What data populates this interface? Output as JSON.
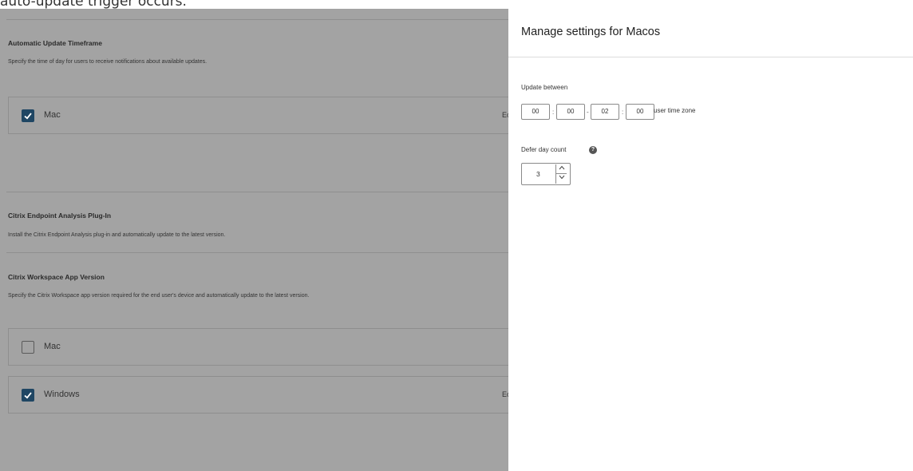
{
  "caption": "auto-update trigger occurs.",
  "background": {
    "update_timeframe": {
      "title": "Automatic Update Timeframe",
      "description": "Specify the time of day for users to receive notifications about available updates.",
      "mac_card": {
        "label": "Mac",
        "checked": true,
        "edit_label": "Ec"
      }
    },
    "epa_plugin": {
      "title": "Citrix Endpoint Analysis Plug-In",
      "description": "Install the Citrix Endpoint Analysis plug-in and automatically update to the latest version."
    },
    "app_version": {
      "title": "Citrix Workspace App Version",
      "description": "Specify the Citrix Workspace app version required for the end user's device and automatically update to the latest version.",
      "mac_card": {
        "label": "Mac",
        "checked": false
      },
      "windows_card": {
        "label": "Windows",
        "checked": true,
        "edit_label": "Ec"
      }
    }
  },
  "panel": {
    "title": "Manage settings for Macos",
    "update_between": {
      "label": "Update between",
      "start_hour": "00",
      "start_minute": "00",
      "end_hour": "02",
      "end_minute": "00",
      "time_separator": ":",
      "range_separator": "-",
      "timezone_label": "user time zone"
    },
    "defer": {
      "label": "Defer day count",
      "help_icon": "?",
      "value": "3",
      "up_arrow": "^",
      "down_arrow": "v"
    }
  },
  "colors": {
    "overlay": "#a3a3a3",
    "checkbox_checked": "#1f4663",
    "panel_bg": "#ffffff"
  }
}
